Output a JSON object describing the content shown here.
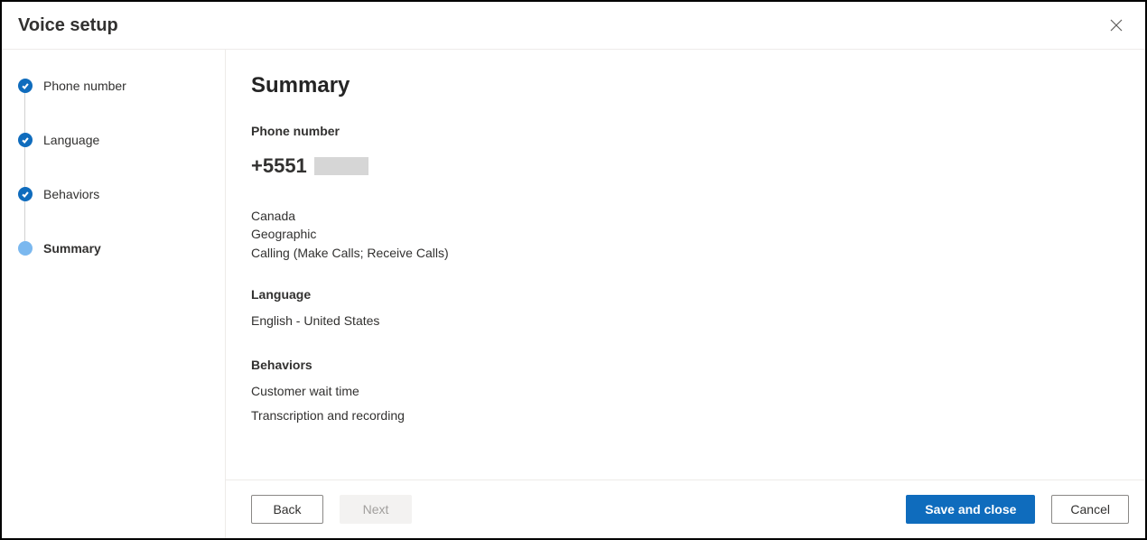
{
  "header": {
    "title": "Voice setup"
  },
  "steps": [
    {
      "label": "Phone number",
      "state": "completed"
    },
    {
      "label": "Language",
      "state": "completed"
    },
    {
      "label": "Behaviors",
      "state": "completed"
    },
    {
      "label": "Summary",
      "state": "current"
    }
  ],
  "summary": {
    "title": "Summary",
    "phoneSection": {
      "label": "Phone number",
      "number": "+5551",
      "country": "Canada",
      "type": "Geographic",
      "capabilities": "Calling (Make Calls; Receive Calls)"
    },
    "languageSection": {
      "label": "Language",
      "value": "English - United States"
    },
    "behaviorsSection": {
      "label": "Behaviors",
      "items": [
        "Customer wait time",
        "Transcription and recording"
      ]
    }
  },
  "footer": {
    "back": "Back",
    "next": "Next",
    "save": "Save and close",
    "cancel": "Cancel"
  }
}
